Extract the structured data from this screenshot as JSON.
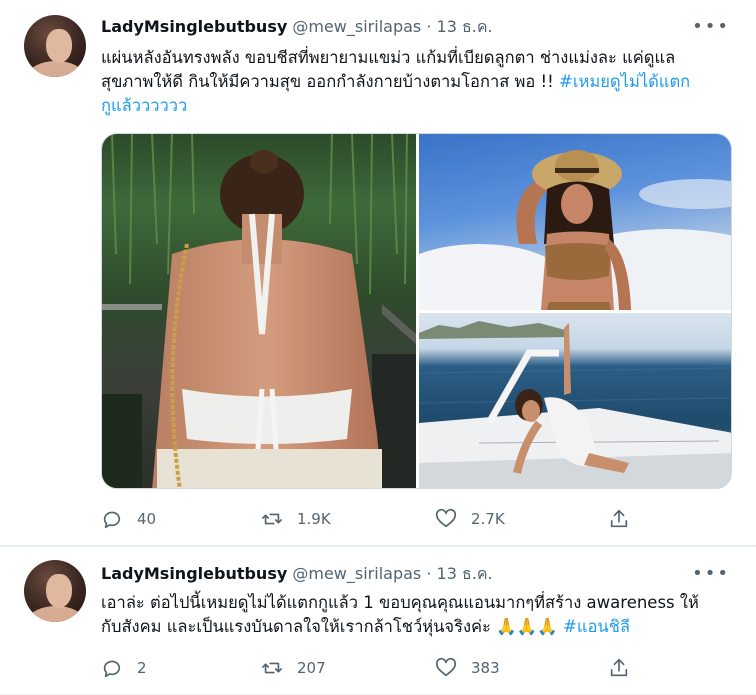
{
  "tweets": [
    {
      "author": {
        "display_name": "LadyMsinglebutbusy",
        "handle": "@mew_sirilapas"
      },
      "separator": "·",
      "date": "13 ธ.ค.",
      "more_icon": "more-horizontal-icon",
      "text_line1": "แผ่นหลังอันทรงพลัง ขอบชีสที่พยายามแขม่ว  แก้มที่เบียดลูกตา ช่างแม่งละ แค่ดูแล",
      "text_line2_plain": "สุขภาพให้ดี กินให้มีความสุข ออกกำลังกายบ้างตามโอกาส พอ !! ",
      "hashtag_part1": "#เหมยดูไม่ได้แตก",
      "hashtag_part2": "กูแล้วววววว",
      "media_alt": [
        "photo-back-halter-top",
        "photo-straw-hat-swimwear",
        "photo-boat-white-swimsuit"
      ],
      "stats": {
        "replies": "40",
        "retweets": "1.9K",
        "likes": "2.7K"
      }
    },
    {
      "author": {
        "display_name": "LadyMsinglebutbusy",
        "handle": "@mew_sirilapas"
      },
      "separator": "·",
      "date": "13 ธ.ค.",
      "more_icon": "more-horizontal-icon",
      "text_line1": "เอาล่ะ ต่อไปนี้เหมยดูไม่ได้แตกกูแล้ว 1 ขอบคุณคุณแอนมากๆที่สร้าง awareness ให้",
      "text_line2_plain": "กับสังคม และเป็นแรงบันดาลใจให้เรากล้าโชว์หุ่นจริงค่ะ 🙏🙏🙏 ",
      "hashtag": "#แอนชิลี",
      "stats": {
        "replies": "2",
        "retweets": "207",
        "likes": "383"
      }
    }
  ],
  "colors": {
    "accent": "#1d9bf0",
    "muted": "#536471",
    "text": "#0f1419"
  }
}
